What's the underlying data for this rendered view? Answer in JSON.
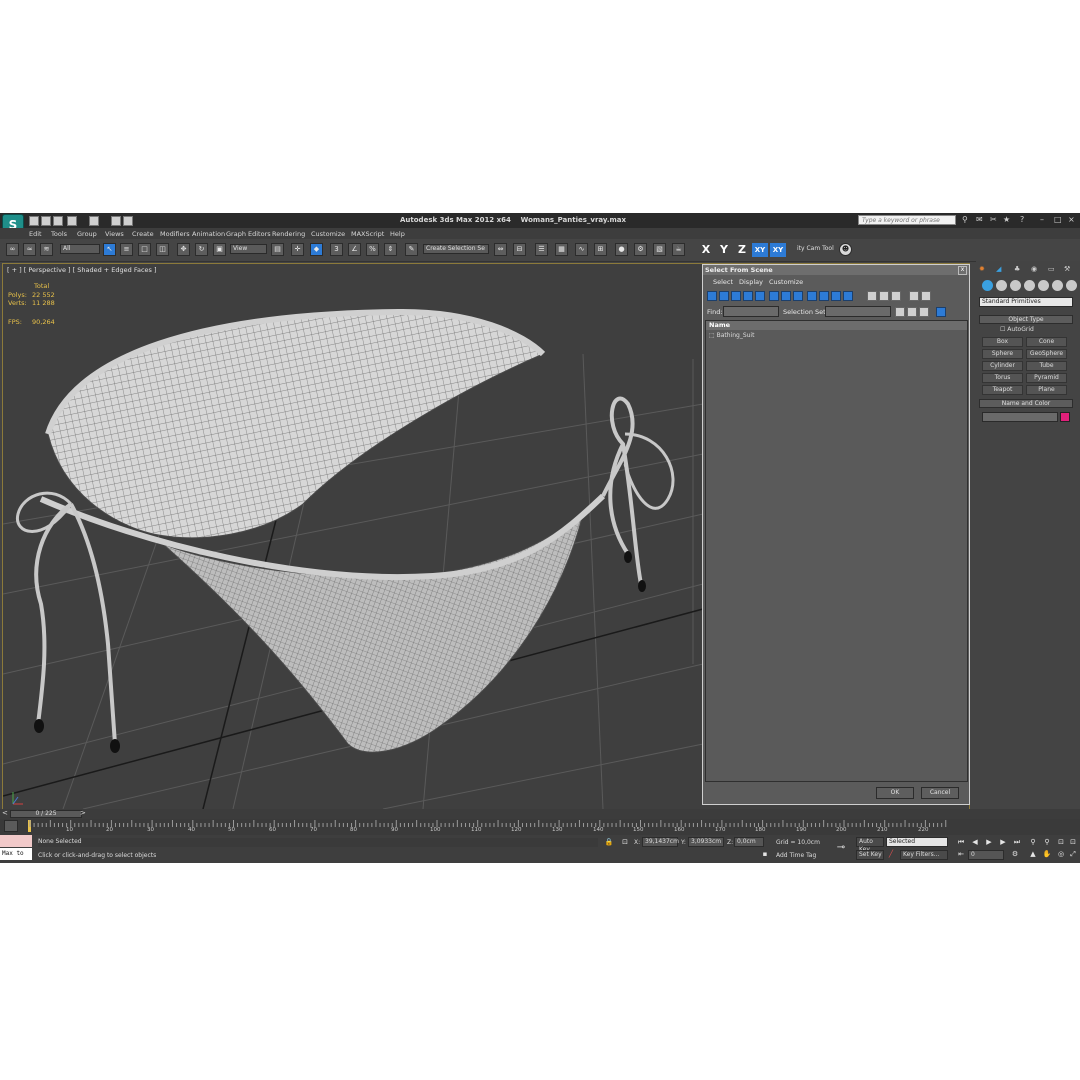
{
  "window": {
    "app_title": "Autodesk 3ds Max  2012 x64",
    "file_name": "Womans_Panties_vray.max",
    "search_placeholder": "Type a keyword or phrase"
  },
  "menus": [
    "Edit",
    "Tools",
    "Group",
    "Views",
    "Create",
    "Modifiers",
    "Animation",
    "Graph Editors",
    "Rendering",
    "Customize",
    "MAXScript",
    "Help"
  ],
  "toolbar": {
    "filter_value": "All",
    "ref_coord": "View",
    "selection_set": "Create Selection Se",
    "axes": [
      "X",
      "Y",
      "Z",
      "XY",
      "XY"
    ],
    "cam_tool": "ity Cam Tool"
  },
  "viewport": {
    "label": "[ + ] [ Perspective ] [ Shaded + Edged Faces ]",
    "stats": {
      "total_label": "Total",
      "polys_label": "Polys:",
      "polys_value": "22 552",
      "verts_label": "Verts:",
      "verts_value": "11 288",
      "fps_label": "FPS:",
      "fps_value": "90,264"
    }
  },
  "dialog": {
    "title": "Select From Scene",
    "close": "x",
    "menus": [
      "Select",
      "Display",
      "Customize"
    ],
    "find_label": "Find:",
    "selection_set_label": "Selection Set:",
    "column_name": "Name",
    "items": [
      "Bathing_Suit"
    ],
    "ok": "OK",
    "cancel": "Cancel"
  },
  "command_panel": {
    "category": "Standard Primitives",
    "object_type_header": "Object Type",
    "autogrid": "AutoGrid",
    "buttons": [
      "Box",
      "Cone",
      "Sphere",
      "GeoSphere",
      "Cylinder",
      "Tube",
      "Torus",
      "Pyramid",
      "Teapot",
      "Plane"
    ],
    "name_color_header": "Name and Color",
    "color_swatch": "#e0207a"
  },
  "timeline": {
    "frame_display": "0 / 225",
    "ticks": [
      "10",
      "20",
      "30",
      "40",
      "50",
      "60",
      "70",
      "80",
      "90",
      "100",
      "110",
      "120",
      "130",
      "140",
      "150",
      "160",
      "170",
      "180",
      "190",
      "200",
      "210",
      "220"
    ]
  },
  "status": {
    "selection": "None Selected",
    "prompt": "Click or click-and-drag to select objects",
    "maxscript": "Max to",
    "x_label": "X:",
    "x_value": "39,1437cm",
    "y_label": "Y:",
    "y_value": "3,0933cm",
    "z_label": "Z:",
    "z_value": "0,0cm",
    "grid": "Grid = 10,0cm",
    "add_time_tag": "Add Time Tag",
    "auto_key": "Auto Key",
    "auto_key_value": "Selected",
    "set_key": "Set Key",
    "key_filters": "Key Filters...",
    "frame_value": "0"
  }
}
